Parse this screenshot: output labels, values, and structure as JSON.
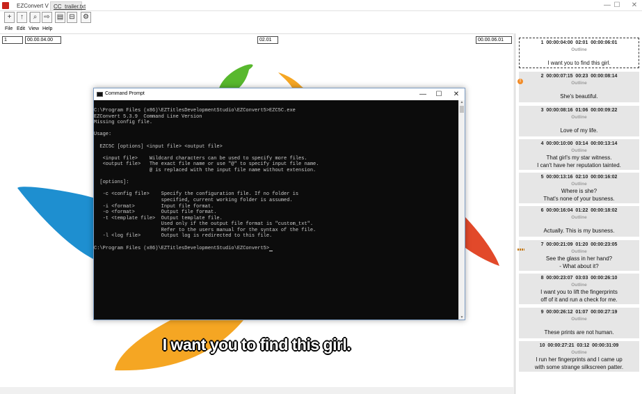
{
  "window": {
    "app_tab": "EZConvert V",
    "file_tab": "CC_trailer.txt",
    "minimize_glyph": "—",
    "maximize_glyph": "☐",
    "close_glyph": "✕"
  },
  "toolbar": {
    "buttons": [
      {
        "icon": "add-icon",
        "glyph": "+"
      },
      {
        "icon": "upload-icon",
        "glyph": "↑"
      },
      {
        "icon": "zoom-icon",
        "glyph": "⌕"
      },
      {
        "icon": "forward-icon",
        "glyph": "⇨"
      },
      {
        "icon": "grid-icon",
        "glyph": "▤"
      },
      {
        "icon": "split-icon",
        "glyph": "⊟"
      },
      {
        "icon": "gear-icon",
        "glyph": "⚙"
      }
    ]
  },
  "menu": {
    "file": "File",
    "edit": "Edit",
    "view": "View",
    "help": "Help"
  },
  "timecodes": {
    "subtitle_number": "1",
    "start": "00.00.04.00",
    "duration": "02.01",
    "end": "00.00.06.01"
  },
  "video": {
    "subtitle": "I want you to find this girl.",
    "logo_colors": {
      "green": "#58b82e",
      "orange": "#f5a623",
      "blue": "#1e8fd0",
      "red": "#e2492a"
    }
  },
  "cmd": {
    "title": "Command Prompt",
    "lines": [
      "C:\\Program Files (x86)\\EZTitlesDevelopmentStudio\\EZConvert5>EZC5C.exe",
      "EZConvert 5.3.9  Command Line Version",
      "Missing config file.",
      "",
      "Usage:",
      "",
      "  EZC5C [options] <input file> <output file>",
      "",
      "   <input file>    Wildcard characters can be used to specify more files.",
      "   <output file>   The exact file name or use \"@\" to specify input file name.",
      "                   @ is replaced with the input file name without extension.",
      "",
      "  [options]:",
      "",
      "   -c <config file>    Specify the configuration file. If no folder is",
      "                       specified, current working folder is assumed.",
      "   -i <format>         Input file format.",
      "   -o <format>         Output file format.",
      "   -t <template file>  Output template file.",
      "                       Used only if the output file format is \"custom_txt\".",
      "                       Refer to the users manual for the syntax of the file.",
      "   -l <log file>       Output log is redirected to this file.",
      "",
      "C:\\Program Files (x86)\\EZTitlesDevelopmentStudio\\EZConvert5>"
    ]
  },
  "subtitles": [
    {
      "num": "1",
      "in": "00:00:04:00",
      "dur": "02:01",
      "out": "00:00:06:01",
      "outline": "Outline",
      "text": "I want you to find this girl.",
      "selected": true
    },
    {
      "num": "2",
      "in": "00:00:07:15",
      "dur": "00:23",
      "out": "00:00:08:14",
      "outline": "Outline",
      "text": "She's beautiful.",
      "warn": "!"
    },
    {
      "num": "3",
      "in": "00:00:08:16",
      "dur": "01:06",
      "out": "00:00:09:22",
      "outline": "Outline",
      "text": "Love of my life."
    },
    {
      "num": "4",
      "in": "00:00:10:00",
      "dur": "03:14",
      "out": "00:00:13:14",
      "outline": "Outline",
      "text": "That girl's my star witness.\nI can't have her reputation tainted."
    },
    {
      "num": "5",
      "in": "00:00:13:16",
      "dur": "02:10",
      "out": "00:00:16:02",
      "outline": "Outline",
      "text": "Where is she?\nThat's none of your busness."
    },
    {
      "num": "6",
      "in": "00:00:16:04",
      "dur": "01:22",
      "out": "00:00:18:02",
      "outline": "Outline",
      "text": "Actually. This is my busness."
    },
    {
      "num": "7",
      "in": "00:00:21:09",
      "dur": "01:20",
      "out": "00:00:23:05",
      "outline": "Outline",
      "text": "See the glass in her hand?\n- What about it?",
      "mark": true
    },
    {
      "num": "8",
      "in": "00:00:23:07",
      "dur": "03:03",
      "out": "00:00:26:10",
      "outline": "Outline",
      "text": "I want you to lift the fingerprints\noff of it and run a check for me."
    },
    {
      "num": "9",
      "in": "00:00:26:12",
      "dur": "01:07",
      "out": "00:00:27:19",
      "outline": "Outline",
      "text": "These prints are not human."
    },
    {
      "num": "10",
      "in": "00:00:27:21",
      "dur": "03:12",
      "out": "00:00:31:09",
      "outline": "Outline",
      "text": "I run her fingerprints and I came up\nwith some strange silkscreen patter."
    }
  ]
}
